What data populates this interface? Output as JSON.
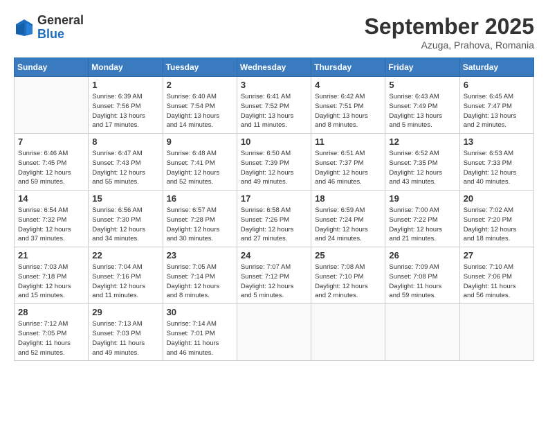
{
  "logo": {
    "general": "General",
    "blue": "Blue"
  },
  "title": "September 2025",
  "subtitle": "Azuga, Prahova, Romania",
  "days_of_week": [
    "Sunday",
    "Monday",
    "Tuesday",
    "Wednesday",
    "Thursday",
    "Friday",
    "Saturday"
  ],
  "weeks": [
    [
      {
        "num": "",
        "info": ""
      },
      {
        "num": "1",
        "info": "Sunrise: 6:39 AM\nSunset: 7:56 PM\nDaylight: 13 hours\nand 17 minutes."
      },
      {
        "num": "2",
        "info": "Sunrise: 6:40 AM\nSunset: 7:54 PM\nDaylight: 13 hours\nand 14 minutes."
      },
      {
        "num": "3",
        "info": "Sunrise: 6:41 AM\nSunset: 7:52 PM\nDaylight: 13 hours\nand 11 minutes."
      },
      {
        "num": "4",
        "info": "Sunrise: 6:42 AM\nSunset: 7:51 PM\nDaylight: 13 hours\nand 8 minutes."
      },
      {
        "num": "5",
        "info": "Sunrise: 6:43 AM\nSunset: 7:49 PM\nDaylight: 13 hours\nand 5 minutes."
      },
      {
        "num": "6",
        "info": "Sunrise: 6:45 AM\nSunset: 7:47 PM\nDaylight: 13 hours\nand 2 minutes."
      }
    ],
    [
      {
        "num": "7",
        "info": "Sunrise: 6:46 AM\nSunset: 7:45 PM\nDaylight: 12 hours\nand 59 minutes."
      },
      {
        "num": "8",
        "info": "Sunrise: 6:47 AM\nSunset: 7:43 PM\nDaylight: 12 hours\nand 55 minutes."
      },
      {
        "num": "9",
        "info": "Sunrise: 6:48 AM\nSunset: 7:41 PM\nDaylight: 12 hours\nand 52 minutes."
      },
      {
        "num": "10",
        "info": "Sunrise: 6:50 AM\nSunset: 7:39 PM\nDaylight: 12 hours\nand 49 minutes."
      },
      {
        "num": "11",
        "info": "Sunrise: 6:51 AM\nSunset: 7:37 PM\nDaylight: 12 hours\nand 46 minutes."
      },
      {
        "num": "12",
        "info": "Sunrise: 6:52 AM\nSunset: 7:35 PM\nDaylight: 12 hours\nand 43 minutes."
      },
      {
        "num": "13",
        "info": "Sunrise: 6:53 AM\nSunset: 7:33 PM\nDaylight: 12 hours\nand 40 minutes."
      }
    ],
    [
      {
        "num": "14",
        "info": "Sunrise: 6:54 AM\nSunset: 7:32 PM\nDaylight: 12 hours\nand 37 minutes."
      },
      {
        "num": "15",
        "info": "Sunrise: 6:56 AM\nSunset: 7:30 PM\nDaylight: 12 hours\nand 34 minutes."
      },
      {
        "num": "16",
        "info": "Sunrise: 6:57 AM\nSunset: 7:28 PM\nDaylight: 12 hours\nand 30 minutes."
      },
      {
        "num": "17",
        "info": "Sunrise: 6:58 AM\nSunset: 7:26 PM\nDaylight: 12 hours\nand 27 minutes."
      },
      {
        "num": "18",
        "info": "Sunrise: 6:59 AM\nSunset: 7:24 PM\nDaylight: 12 hours\nand 24 minutes."
      },
      {
        "num": "19",
        "info": "Sunrise: 7:00 AM\nSunset: 7:22 PM\nDaylight: 12 hours\nand 21 minutes."
      },
      {
        "num": "20",
        "info": "Sunrise: 7:02 AM\nSunset: 7:20 PM\nDaylight: 12 hours\nand 18 minutes."
      }
    ],
    [
      {
        "num": "21",
        "info": "Sunrise: 7:03 AM\nSunset: 7:18 PM\nDaylight: 12 hours\nand 15 minutes."
      },
      {
        "num": "22",
        "info": "Sunrise: 7:04 AM\nSunset: 7:16 PM\nDaylight: 12 hours\nand 11 minutes."
      },
      {
        "num": "23",
        "info": "Sunrise: 7:05 AM\nSunset: 7:14 PM\nDaylight: 12 hours\nand 8 minutes."
      },
      {
        "num": "24",
        "info": "Sunrise: 7:07 AM\nSunset: 7:12 PM\nDaylight: 12 hours\nand 5 minutes."
      },
      {
        "num": "25",
        "info": "Sunrise: 7:08 AM\nSunset: 7:10 PM\nDaylight: 12 hours\nand 2 minutes."
      },
      {
        "num": "26",
        "info": "Sunrise: 7:09 AM\nSunset: 7:08 PM\nDaylight: 11 hours\nand 59 minutes."
      },
      {
        "num": "27",
        "info": "Sunrise: 7:10 AM\nSunset: 7:06 PM\nDaylight: 11 hours\nand 56 minutes."
      }
    ],
    [
      {
        "num": "28",
        "info": "Sunrise: 7:12 AM\nSunset: 7:05 PM\nDaylight: 11 hours\nand 52 minutes."
      },
      {
        "num": "29",
        "info": "Sunrise: 7:13 AM\nSunset: 7:03 PM\nDaylight: 11 hours\nand 49 minutes."
      },
      {
        "num": "30",
        "info": "Sunrise: 7:14 AM\nSunset: 7:01 PM\nDaylight: 11 hours\nand 46 minutes."
      },
      {
        "num": "",
        "info": ""
      },
      {
        "num": "",
        "info": ""
      },
      {
        "num": "",
        "info": ""
      },
      {
        "num": "",
        "info": ""
      }
    ]
  ]
}
